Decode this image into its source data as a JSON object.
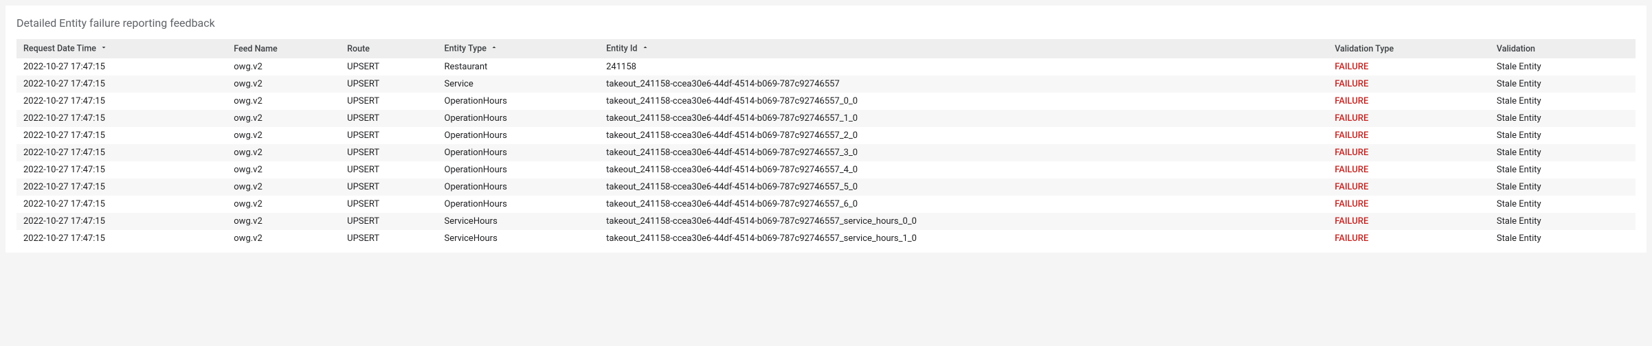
{
  "panel": {
    "title": "Detailed Entity failure reporting feedback"
  },
  "table": {
    "headers": {
      "request_date_time": "Request Date Time",
      "feed_name": "Feed Name",
      "route": "Route",
      "entity_type": "Entity Type",
      "entity_id": "Entity Id",
      "validation_type": "Validation Type",
      "validation": "Validation"
    },
    "rows": [
      {
        "dt": "2022-10-27 17:47:15",
        "feed": "owg.v2",
        "route": "UPSERT",
        "etype": "Restaurant",
        "eid": "241158",
        "vtype": "FAILURE",
        "val": "Stale Entity"
      },
      {
        "dt": "2022-10-27 17:47:15",
        "feed": "owg.v2",
        "route": "UPSERT",
        "etype": "Service",
        "eid": "takeout_241158-ccea30e6-44df-4514-b069-787c92746557",
        "vtype": "FAILURE",
        "val": "Stale Entity"
      },
      {
        "dt": "2022-10-27 17:47:15",
        "feed": "owg.v2",
        "route": "UPSERT",
        "etype": "OperationHours",
        "eid": "takeout_241158-ccea30e6-44df-4514-b069-787c92746557_0_0",
        "vtype": "FAILURE",
        "val": "Stale Entity"
      },
      {
        "dt": "2022-10-27 17:47:15",
        "feed": "owg.v2",
        "route": "UPSERT",
        "etype": "OperationHours",
        "eid": "takeout_241158-ccea30e6-44df-4514-b069-787c92746557_1_0",
        "vtype": "FAILURE",
        "val": "Stale Entity"
      },
      {
        "dt": "2022-10-27 17:47:15",
        "feed": "owg.v2",
        "route": "UPSERT",
        "etype": "OperationHours",
        "eid": "takeout_241158-ccea30e6-44df-4514-b069-787c92746557_2_0",
        "vtype": "FAILURE",
        "val": "Stale Entity"
      },
      {
        "dt": "2022-10-27 17:47:15",
        "feed": "owg.v2",
        "route": "UPSERT",
        "etype": "OperationHours",
        "eid": "takeout_241158-ccea30e6-44df-4514-b069-787c92746557_3_0",
        "vtype": "FAILURE",
        "val": "Stale Entity"
      },
      {
        "dt": "2022-10-27 17:47:15",
        "feed": "owg.v2",
        "route": "UPSERT",
        "etype": "OperationHours",
        "eid": "takeout_241158-ccea30e6-44df-4514-b069-787c92746557_4_0",
        "vtype": "FAILURE",
        "val": "Stale Entity"
      },
      {
        "dt": "2022-10-27 17:47:15",
        "feed": "owg.v2",
        "route": "UPSERT",
        "etype": "OperationHours",
        "eid": "takeout_241158-ccea30e6-44df-4514-b069-787c92746557_5_0",
        "vtype": "FAILURE",
        "val": "Stale Entity"
      },
      {
        "dt": "2022-10-27 17:47:15",
        "feed": "owg.v2",
        "route": "UPSERT",
        "etype": "OperationHours",
        "eid": "takeout_241158-ccea30e6-44df-4514-b069-787c92746557_6_0",
        "vtype": "FAILURE",
        "val": "Stale Entity"
      },
      {
        "dt": "2022-10-27 17:47:15",
        "feed": "owg.v2",
        "route": "UPSERT",
        "etype": "ServiceHours",
        "eid": "takeout_241158-ccea30e6-44df-4514-b069-787c92746557_service_hours_0_0",
        "vtype": "FAILURE",
        "val": "Stale Entity"
      },
      {
        "dt": "2022-10-27 17:47:15",
        "feed": "owg.v2",
        "route": "UPSERT",
        "etype": "ServiceHours",
        "eid": "takeout_241158-ccea30e6-44df-4514-b069-787c92746557_service_hours_1_0",
        "vtype": "FAILURE",
        "val": "Stale Entity"
      }
    ]
  }
}
